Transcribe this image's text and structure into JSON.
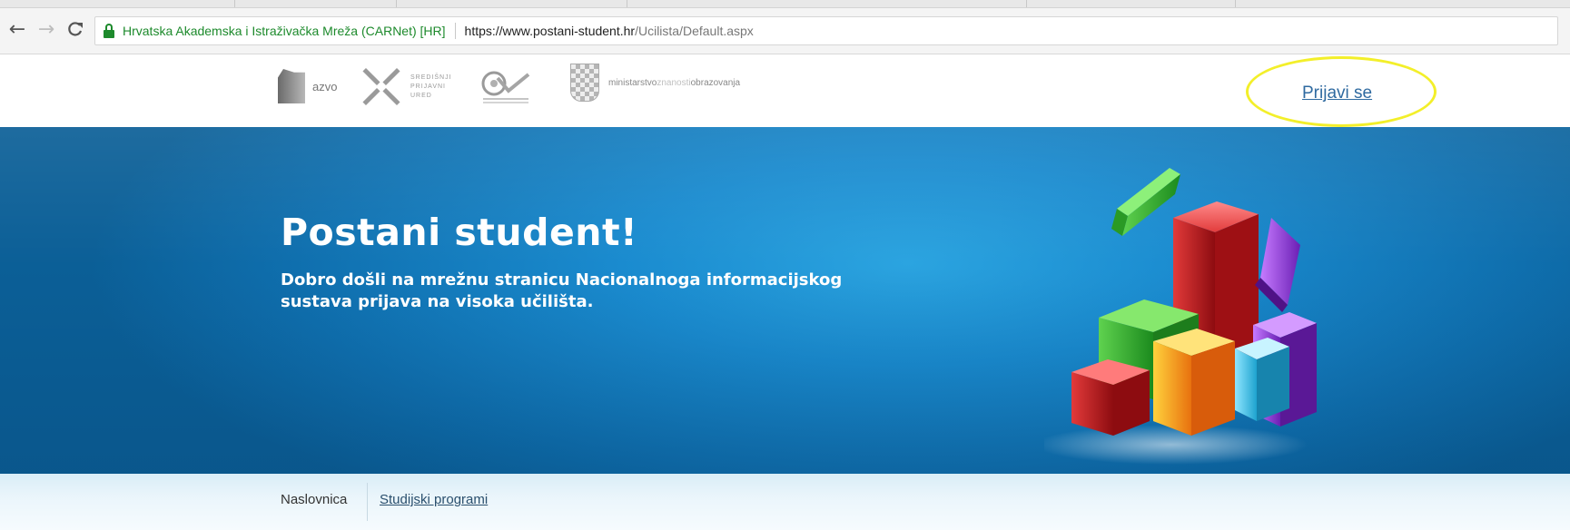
{
  "browser": {
    "nav": {
      "back_icon": "arrow-left-icon",
      "forward_icon": "arrow-right-icon",
      "reload_icon": "reload-icon"
    },
    "address_bar": {
      "organization": "Hrvatska Akademska i Istraživačka Mreža (CARNet) [HR]",
      "url_host": "https://www.postani-student.hr",
      "url_path": "/Ucilista/Default.aspx"
    }
  },
  "header": {
    "logos": {
      "azvo_text": "azvo",
      "sredisnji_lines": [
        "SREDIŠNJI",
        "PRIJAVNI",
        "URED"
      ],
      "ministry_prefix": "ministarstvo",
      "ministry_mid": "znanosti",
      "ministry_suffix": "obrazovanja"
    },
    "login_link": "Prijavi se",
    "highlight_color": "#f3ef2a"
  },
  "hero": {
    "title": "Postani student!",
    "subtitle": "Dobro došli na mrežnu stranicu Nacionalnoga informacijskog sustava prijava na visoka učilišta."
  },
  "menu": {
    "items": [
      {
        "label": "Naslovnica"
      },
      {
        "label": "Studijski programi"
      }
    ]
  },
  "colors": {
    "hero_blue": "#1a8bcf",
    "link_blue": "#2f6aa0",
    "secure_green": "#1d8a2c"
  }
}
